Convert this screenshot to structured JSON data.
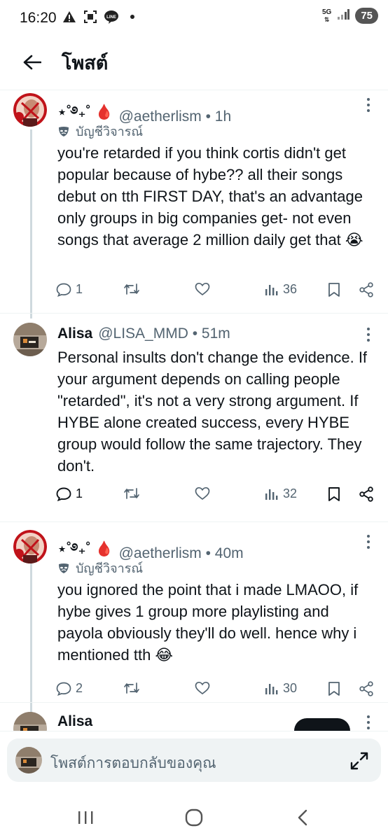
{
  "status_bar": {
    "time": "16:20",
    "network": "5G",
    "battery": "75"
  },
  "header": {
    "title": "โพสต์"
  },
  "tweets": [
    {
      "name": "⋆˚࿔₊˚ 🩸",
      "handle": "@aetherlism • 1h",
      "badge": "บัญชีวิจารณ์",
      "text": "you're retarded if you think cortis didn't get popular because of hybe?? all their songs debut on tth FIRST DAY, that's an advantage only groups in big companies get- not even songs that average 2 million daily get that 😭",
      "replies": "1",
      "retweets": "",
      "likes": "",
      "views": "36"
    },
    {
      "name": "Alisa",
      "handle": "@LISA_MMD • 51m",
      "text": "Personal insults don't change the evidence. If your argument depends on calling people \"retarded\", it's not a very strong argument. If HYBE alone created success, every HYBE group would follow the same trajectory. They don't.",
      "replies": "1",
      "retweets": "",
      "likes": "",
      "views": "32"
    },
    {
      "name": "⋆˚࿔₊˚ 🩸",
      "handle": "@aetherlism • 40m",
      "badge": "บัญชีวิจารณ์",
      "text": "you ignored the point that i made LMAOO, if hybe gives 1 group more playlisting and payola obviously they'll do well. hence why i mentioned tth 😂",
      "replies": "2",
      "retweets": "",
      "likes": "",
      "views": "30"
    },
    {
      "name": "Alisa"
    }
  ],
  "reply_bar": {
    "placeholder": "โพสต์การตอบกลับของคุณ"
  },
  "colors": {
    "text": "#0f1419",
    "secondary": "#536471",
    "thread_line": "#cfd9de",
    "reply_bg": "#eff3f4"
  }
}
